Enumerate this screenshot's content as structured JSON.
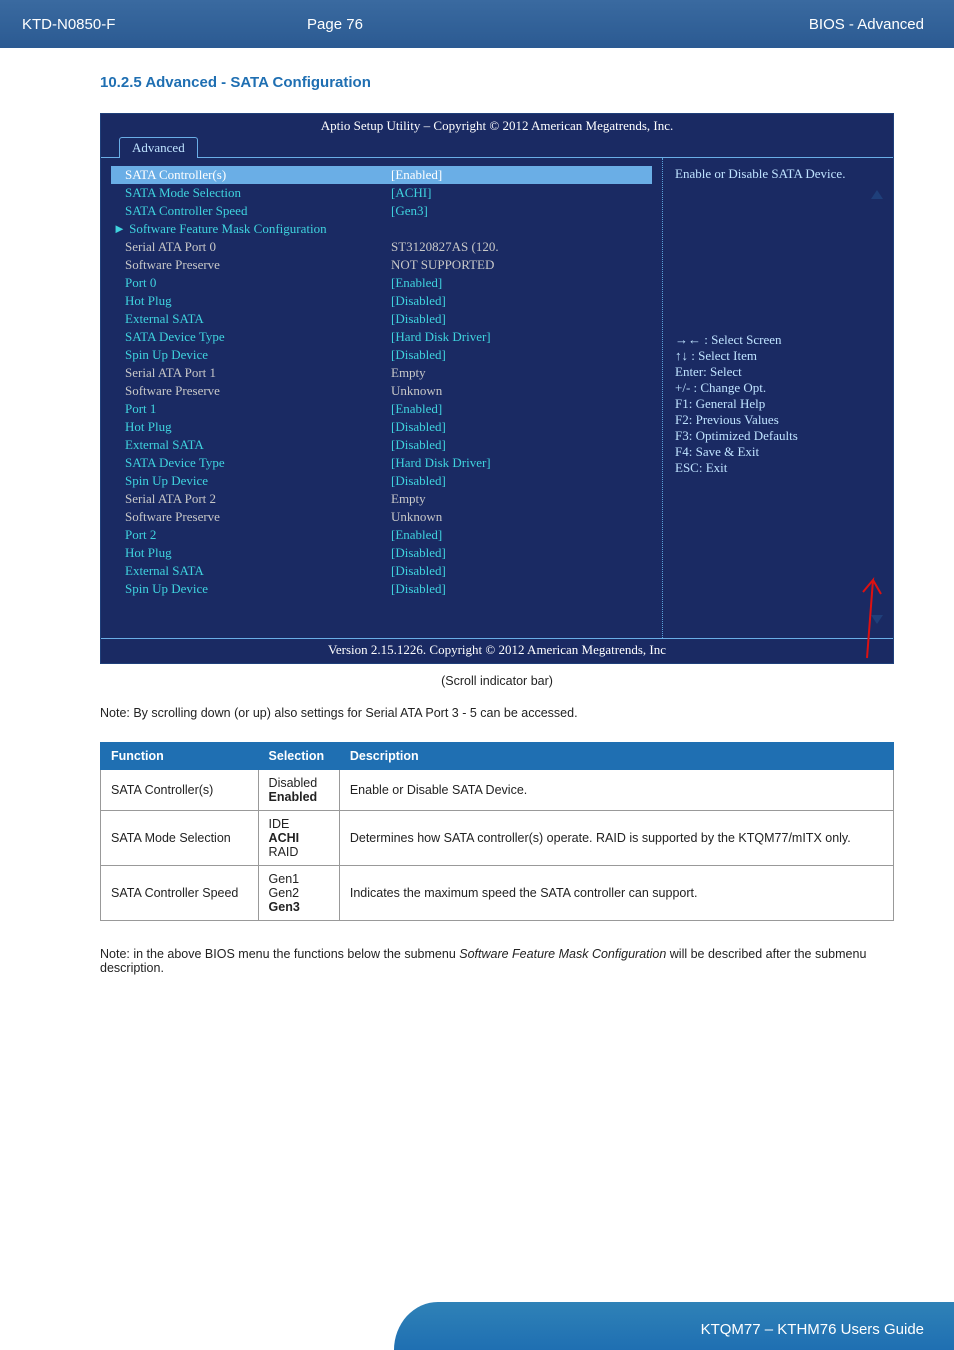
{
  "doc": {
    "code": "KTD-N0850-F",
    "page_label": "Page 76",
    "section": "BIOS - Advanced",
    "section_title": "10.2.5  Advanced  -  SATA Configuration",
    "footer_guide": "KTQM77 – KTHM76 Users Guide"
  },
  "bios": {
    "top_title": "Aptio Setup Utility  –  Copyright © 2012 American Megatrends, Inc.",
    "tab": "Advanced",
    "footer": "Version 2.15.1226. Copyright © 2012 American Megatrends, Inc",
    "help_top": "Enable or Disable SATA Device.",
    "help_keys": [
      "→← : Select Screen",
      "↑↓ : Select Item",
      "Enter: Select",
      "+/- : Change Opt.",
      "F1: General Help",
      "F2: Previous Values",
      "F3: Optimized Defaults",
      "F4: Save & Exit",
      "ESC: Exit"
    ],
    "rows": [
      {
        "k": "SATA Controller(s)",
        "v": "[Enabled]",
        "ks": "hl",
        "vs": "hl"
      },
      {
        "k": "SATA Mode Selection",
        "v": "[ACHI]",
        "ks": "cyan",
        "vs": "cyan"
      },
      {
        "k": "SATA Controller Speed",
        "v": "[Gen3]",
        "ks": "cyan",
        "vs": "cyan"
      },
      {
        "k": "► Software Feature Mask Configuration",
        "v": "",
        "ks": "cyan arrowline",
        "vs": ""
      },
      {
        "k": "",
        "v": ""
      },
      {
        "k": "Serial ATA Port 0",
        "v": "ST3120827AS  (120.",
        "ks": "gray",
        "vs": "gray"
      },
      {
        "k": "  Software Preserve",
        "v": "NOT SUPPORTED",
        "ks": "gray",
        "vs": "gray"
      },
      {
        "k": "  Port 0",
        "v": "[Enabled]",
        "ks": "cyan",
        "vs": "cyan"
      },
      {
        "k": "  Hot Plug",
        "v": "[Disabled]",
        "ks": "cyan",
        "vs": "cyan"
      },
      {
        "k": "  External SATA",
        "v": "[Disabled]",
        "ks": "cyan",
        "vs": "cyan"
      },
      {
        "k": "  SATA Device Type",
        "v": "[Hard Disk Driver]",
        "ks": "cyan",
        "vs": "cyan"
      },
      {
        "k": "  Spin Up Device",
        "v": "[Disabled]",
        "ks": "cyan",
        "vs": "cyan"
      },
      {
        "k": "Serial ATA Port 1",
        "v": "Empty",
        "ks": "gray",
        "vs": "gray"
      },
      {
        "k": "  Software Preserve",
        "v": "Unknown",
        "ks": "gray",
        "vs": "gray"
      },
      {
        "k": "  Port 1",
        "v": "[Enabled]",
        "ks": "cyan",
        "vs": "cyan"
      },
      {
        "k": "  Hot Plug",
        "v": "[Disabled]",
        "ks": "cyan",
        "vs": "cyan"
      },
      {
        "k": "  External SATA",
        "v": "[Disabled]",
        "ks": "cyan",
        "vs": "cyan"
      },
      {
        "k": "  SATA Device Type",
        "v": "[Hard Disk Driver]",
        "ks": "cyan",
        "vs": "cyan"
      },
      {
        "k": "  Spin Up Device",
        "v": "[Disabled]",
        "ks": "cyan",
        "vs": "cyan"
      },
      {
        "k": "Serial ATA Port 2",
        "v": "Empty",
        "ks": "gray",
        "vs": "gray"
      },
      {
        "k": "  Software Preserve",
        "v": "Unknown",
        "ks": "gray",
        "vs": "gray"
      },
      {
        "k": "  Port 2",
        "v": "[Enabled]",
        "ks": "cyan",
        "vs": "cyan"
      },
      {
        "k": "  Hot Plug",
        "v": "[Disabled]",
        "ks": "cyan",
        "vs": "cyan"
      },
      {
        "k": "  External SATA",
        "v": "[Disabled]",
        "ks": "cyan",
        "vs": "cyan"
      },
      {
        "k": "  Spin Up Device",
        "v": "[Disabled]",
        "ks": "cyan",
        "vs": "cyan"
      }
    ]
  },
  "notes": {
    "scroll_caption": "(Scroll indicator bar)",
    "scroll_note": "Note: By scrolling down (or up) also settings for Serial ATA Port 3 - 5 can be accessed.",
    "below_note_1": "Note: in the above BIOS menu the functions below the submenu ",
    "below_note_em": "Software Feature Mask Configuration",
    "below_note_2": " will be described after the submenu description."
  },
  "table": {
    "headers": [
      "Function",
      "Selection",
      "Description"
    ],
    "rows": [
      {
        "func": "SATA Controller(s)",
        "sel": [
          "Disabled",
          "Enabled"
        ],
        "bold": [
          false,
          true
        ],
        "desc": "Enable or Disable SATA Device."
      },
      {
        "func": "SATA Mode Selection",
        "sel": [
          "IDE",
          "ACHI",
          "RAID"
        ],
        "bold": [
          false,
          true,
          false
        ],
        "desc": "Determines how SATA controller(s) operate. RAID is supported by the KTQM77/mITX only."
      },
      {
        "func": "SATA Controller Speed",
        "sel": [
          "Gen1",
          "Gen2",
          "Gen3"
        ],
        "bold": [
          false,
          false,
          true
        ],
        "desc": "Indicates the maximum speed the SATA controller can support."
      }
    ]
  }
}
